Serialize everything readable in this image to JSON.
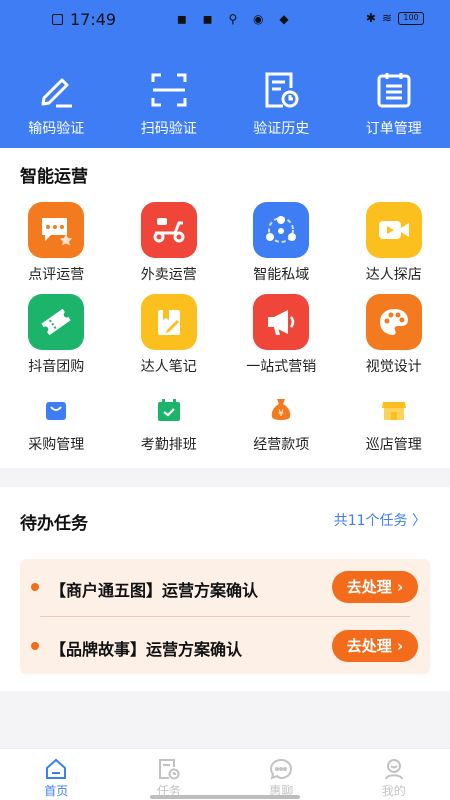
{
  "status_bar": {
    "time": "17:49",
    "battery": "100"
  },
  "quick_actions": [
    {
      "label": "输码验证",
      "icon": "pencil-icon"
    },
    {
      "label": "扫码验证",
      "icon": "scan-icon"
    },
    {
      "label": "验证历史",
      "icon": "history-icon"
    },
    {
      "label": "订单管理",
      "icon": "order-list-icon"
    }
  ],
  "smart_ops": {
    "title": "智能运营",
    "items": [
      {
        "label": "点评运营",
        "color": "#f47a1f",
        "icon": "review-chat-icon"
      },
      {
        "label": "外卖运营",
        "color": "#f0463a",
        "icon": "scooter-icon"
      },
      {
        "label": "智能私域",
        "color": "#3f7df4",
        "icon": "people-network-icon"
      },
      {
        "label": "达人探店",
        "color": "#fbbf1e",
        "icon": "video-camera-icon"
      },
      {
        "label": "抖音团购",
        "color": "#1cb36b",
        "icon": "ticket-icon"
      },
      {
        "label": "达人笔记",
        "color": "#fbbf1e",
        "icon": "notebook-icon"
      },
      {
        "label": "一站式营销",
        "color": "#f0463a",
        "icon": "megaphone-icon"
      },
      {
        "label": "视觉设计",
        "color": "#f47a1f",
        "icon": "palette-icon"
      },
      {
        "label": "采购管理",
        "color": "#3f7df4",
        "icon": "shopping-bag-icon"
      },
      {
        "label": "考勤排班",
        "color": "#1cb36b",
        "icon": "calendar-check-icon"
      },
      {
        "label": "经营款项",
        "color": "#f47a1f",
        "icon": "money-bag-icon"
      },
      {
        "label": "巡店管理",
        "color": "#fbbf1e",
        "icon": "store-icon"
      }
    ]
  },
  "todo": {
    "title": "待办任务",
    "more": "共11个任务 ",
    "tasks": [
      {
        "text": "【商户通五图】运营方案确认",
        "action": "去处理 ›"
      },
      {
        "text": "【品牌故事】运营方案确认",
        "action": "去处理 ›"
      }
    ]
  },
  "tabbar": [
    {
      "label": "首页",
      "icon": "home-icon",
      "active": true
    },
    {
      "label": "任务",
      "icon": "task-icon",
      "active": false
    },
    {
      "label": "惠聊",
      "icon": "chat-icon",
      "active": false
    },
    {
      "label": "我的",
      "icon": "profile-icon",
      "active": false
    }
  ]
}
